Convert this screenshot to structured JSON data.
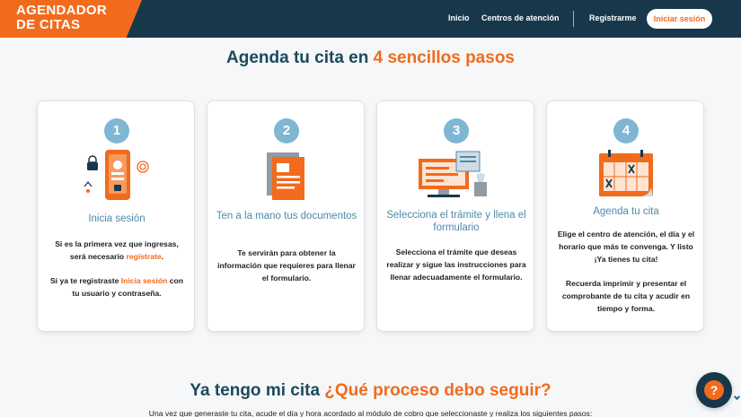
{
  "header": {
    "brand_line1": "AGENDADOR",
    "brand_line2": "DE CITAS",
    "nav": {
      "home": "Inicio",
      "centers": "Centros de atención",
      "register": "Registrarme",
      "login": "Iniciar sesión"
    }
  },
  "heading": {
    "prefix": "Agenda tu cita en ",
    "highlight": "4 sencillos pasos"
  },
  "steps": [
    {
      "number": "1",
      "title": "Inicia sesión",
      "icon": "phone-login-icon",
      "p1_a": "Si es la primera vez que ingresas, será necesario ",
      "p1_link": "regístrate",
      "p1_b": ".",
      "p2_a": "Si ya te registraste ",
      "p2_link": "Inicia sesión",
      "p2_b": " con tu usuario y contraseña."
    },
    {
      "number": "2",
      "title": "Ten a la mano tus documentos",
      "icon": "documents-icon",
      "body": "Te servirán para obtener la información que requieres para llenar el formulario."
    },
    {
      "number": "3",
      "title": "Selecciona el trámite y llena el formulario",
      "icon": "computer-form-icon",
      "body": "Selecciona el trámite que deseas realizar y sigue las instrucciones para llenar adecuadamente el formulario."
    },
    {
      "number": "4",
      "title": "Agenda tu cita",
      "icon": "calendar-icon",
      "p1": "Elige el centro de atención, el día y el horario que más te convenga. Y listo ¡Ya tienes tu cita!",
      "p2": "Recuerda imprimir y presentar el comprobante de tu cita y acudir en tiempo y forma."
    }
  ],
  "section2": {
    "prefix": "Ya tengo mi cita ",
    "highlight": "¿Qué proceso debo seguir?",
    "intro": "Una vez que generaste tu cita, acude el día y hora acordado al módulo de cobro que seleccionaste y realiza los siguientes pasos:"
  },
  "help": {
    "icon": "help-chat-icon",
    "glyph": "?"
  },
  "colors": {
    "brand": "#f26b1d",
    "navy": "#17384a",
    "title": "#1b4a5e",
    "step_circle": "#7fb6d3",
    "card_title": "#4e8aab"
  }
}
